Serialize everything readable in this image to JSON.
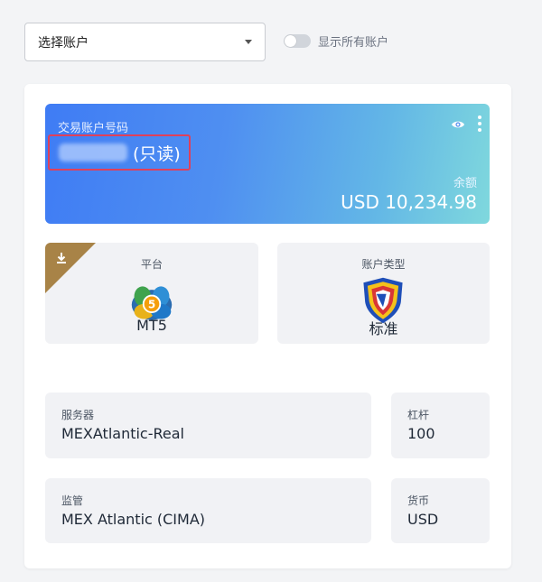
{
  "account_select": {
    "label": "选择账户"
  },
  "show_all": {
    "label": "显示所有账户",
    "enabled": false
  },
  "account_card": {
    "title": "交易账户号码",
    "readonly_tag": "(只读)",
    "balance_label": "余额",
    "balance_value": "USD 10,234.98",
    "icons": [
      "eye-icon",
      "more-vertical-icon"
    ]
  },
  "platform": {
    "caption": "平台",
    "value": "MT5",
    "icon": "metatrader5-logo",
    "ribbon_icon": "download-icon"
  },
  "account_type": {
    "caption": "账户类型",
    "value": "标准",
    "icon": "shield-logo"
  },
  "server": {
    "label": "服务器",
    "value": "MEXAtlantic-Real"
  },
  "leverage": {
    "label": "杠杆",
    "value": "100"
  },
  "regulation": {
    "label": "监管",
    "value": "MEX Atlantic (CIMA)"
  },
  "currency": {
    "label": "货币",
    "value": "USD"
  },
  "colors": {
    "card_gradient_start": "#3f7cf4",
    "card_gradient_end": "#7fd8dd",
    "highlight_border": "#e0405a",
    "ribbon": "#a88347"
  }
}
